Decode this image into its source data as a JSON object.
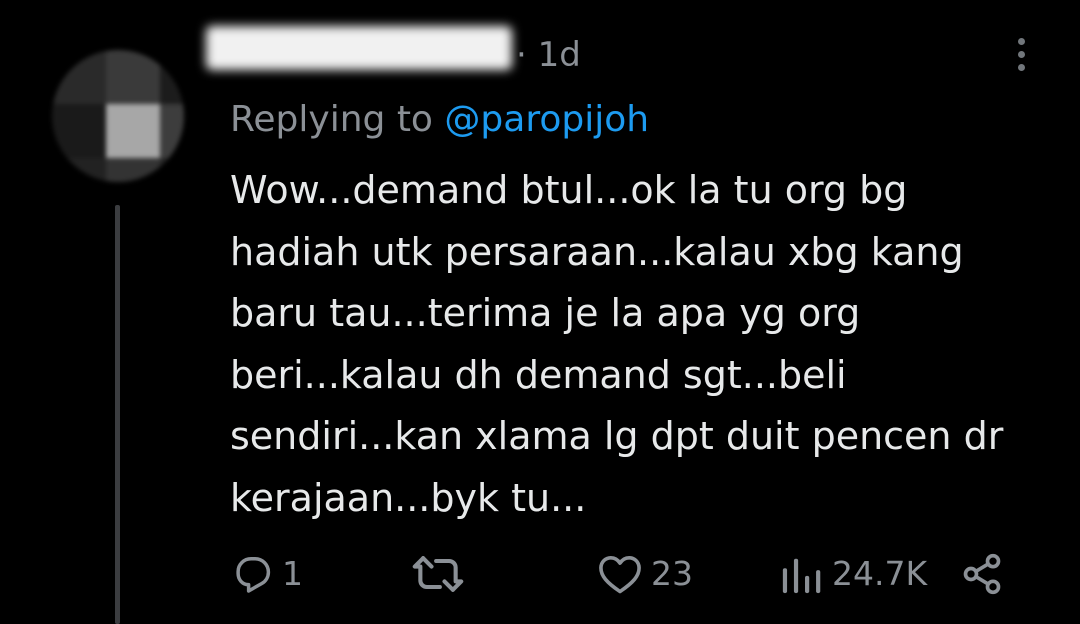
{
  "tweet": {
    "time": "· 1d",
    "replying_prefix": "Replying to ",
    "replying_handle": "@paropijoh",
    "body_lines": [
      "Wow...demand btul...ok la tu org bg",
      "hadiah utk persaraan...kalau xbg kang",
      "baru tau...terima je la apa yg org",
      "beri...kalau dh demand sgt...beli",
      "sendiri...kan xlama lg dpt duit pencen dr",
      "kerajaan...byk tu..."
    ]
  },
  "actions": {
    "reply_count": "1",
    "retweet_count": "",
    "like_count": "23",
    "view_count": "24.7K"
  },
  "icons": {
    "more": "more-vertical-icon",
    "reply": "reply-icon",
    "retweet": "retweet-icon",
    "like": "heart-icon",
    "views": "views-icon",
    "share": "share-icon"
  },
  "colors": {
    "background": "#000000",
    "text": "#e7e9ea",
    "secondary": "#8b9096",
    "accent": "#1d9bf0"
  }
}
